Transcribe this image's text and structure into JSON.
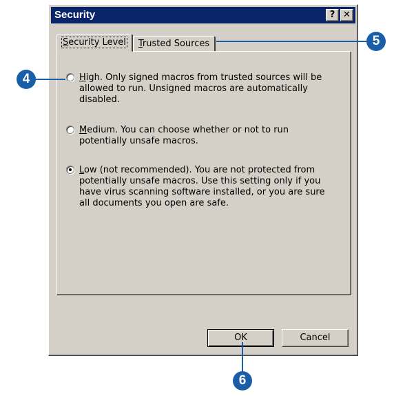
{
  "window": {
    "title": "Security",
    "help_glyph": "?",
    "close_glyph": "✕"
  },
  "tabs": [
    {
      "label": "Security Level",
      "accel": "S",
      "rest": "ecurity Level",
      "active": true
    },
    {
      "label": "Trusted Sources",
      "accel": "T",
      "rest": "rusted Sources",
      "active": false
    }
  ],
  "options": [
    {
      "accel": "H",
      "text_rest": "igh. Only signed macros from trusted sources will be allowed to run. Unsigned macros are automatically disabled.",
      "checked": false
    },
    {
      "accel": "M",
      "text_rest": "edium. You can choose whether or not to run potentially unsafe macros.",
      "checked": false
    },
    {
      "accel": "L",
      "text_rest": "ow (not recommended). You are not protected from potentially unsafe macros. Use this setting only if you have virus scanning software installed, or you are sure all documents you open are safe.",
      "checked": true
    }
  ],
  "buttons": {
    "ok": "OK",
    "cancel": "Cancel"
  },
  "callouts": {
    "four": "4",
    "five": "5",
    "six": "6"
  },
  "colors": {
    "titlebar": "#0a246a",
    "dialog_face": "#d4d0c8",
    "callout": "#1a5ea8"
  }
}
